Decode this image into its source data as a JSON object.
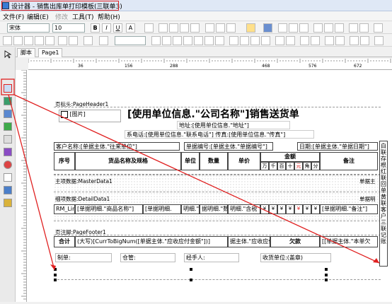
{
  "window": {
    "title": "设计器 - 销售出库单打印模板(三联单3)"
  },
  "menu": [
    "文件(F)",
    "编辑(E)",
    "修改",
    "工具(T)",
    "帮助(H)"
  ],
  "toolbar1": {
    "font_name": "宋体",
    "font_size": "10",
    "bold": "B",
    "italic": "I",
    "underline": "U",
    "color": "A"
  },
  "tabs": {
    "script": "脚本",
    "page": "Page1"
  },
  "ruler": {
    "marks": [
      "36",
      "156",
      "288",
      "468",
      "576",
      "672"
    ],
    "vmarks": [
      "0",
      "36",
      "108",
      "156",
      "288"
    ]
  },
  "bands": {
    "page_header": "页标头:PageHeader1",
    "master": "主项数据:MasterData1",
    "detail": "细项数据:DetailData1",
    "page_footer": "页注脚:PageFooter1",
    "master_right": "单据主",
    "detail_right": "单据明"
  },
  "header": {
    "image": "[图片]",
    "title": "[使用单位信息.\"公司名称\"]销售送货单",
    "address": "地址:[使用单位信息.\"地址\"]",
    "phone_fax": "系电话:[使用单位信息.\"联系电话\"]  传真:[使用单位信息.\"传真\"]",
    "customer": "客户名称:[单据主体.\"往来单位\"]",
    "doc_no": "单据编号:[单据主体.\"单据编号\"]",
    "date": "日期:[单据主体.\"单据日期\"]"
  },
  "columns": {
    "seq": "序号",
    "name": "货品名称及规格",
    "unit": "单位",
    "qty": "数量",
    "price": "单价",
    "amount": "金额",
    "amount_digits": [
      "万",
      "千",
      "百",
      "十",
      "元",
      "角",
      "分"
    ],
    "remark": "备注"
  },
  "detail_row": {
    "seq": "RM_Lin",
    "name": "[单据明细.\"商品名称\"]",
    "spec": "[单据明细.",
    "unit": "明细.\"",
    "qty": "据明细.\"数",
    "price": "明细.\"含税",
    "digits": [
      "¥",
      "¥",
      "¥",
      "¥",
      "¥",
      "¥",
      "¥"
    ],
    "remark": "[单据明细.\"备注\"]"
  },
  "footer": {
    "total": "合计",
    "big_amount": "(大写)[CurrToBigNum([单据主体.\"应收应付金额\"])]",
    "small_amount": "据主体.\"应收应付金",
    "owed": "欠款",
    "owed_value": "[[单据主体.\"本单欠",
    "maker": "制单:",
    "warehouse": "仓管:",
    "handler": "经手人:",
    "receiver": "收货单位:(盖章)"
  },
  "side_note": "白联存根 红联回单 黄联客户 三联记账",
  "colors": {
    "annotation": "#e02020",
    "titlebar": "#dfe8f6"
  }
}
